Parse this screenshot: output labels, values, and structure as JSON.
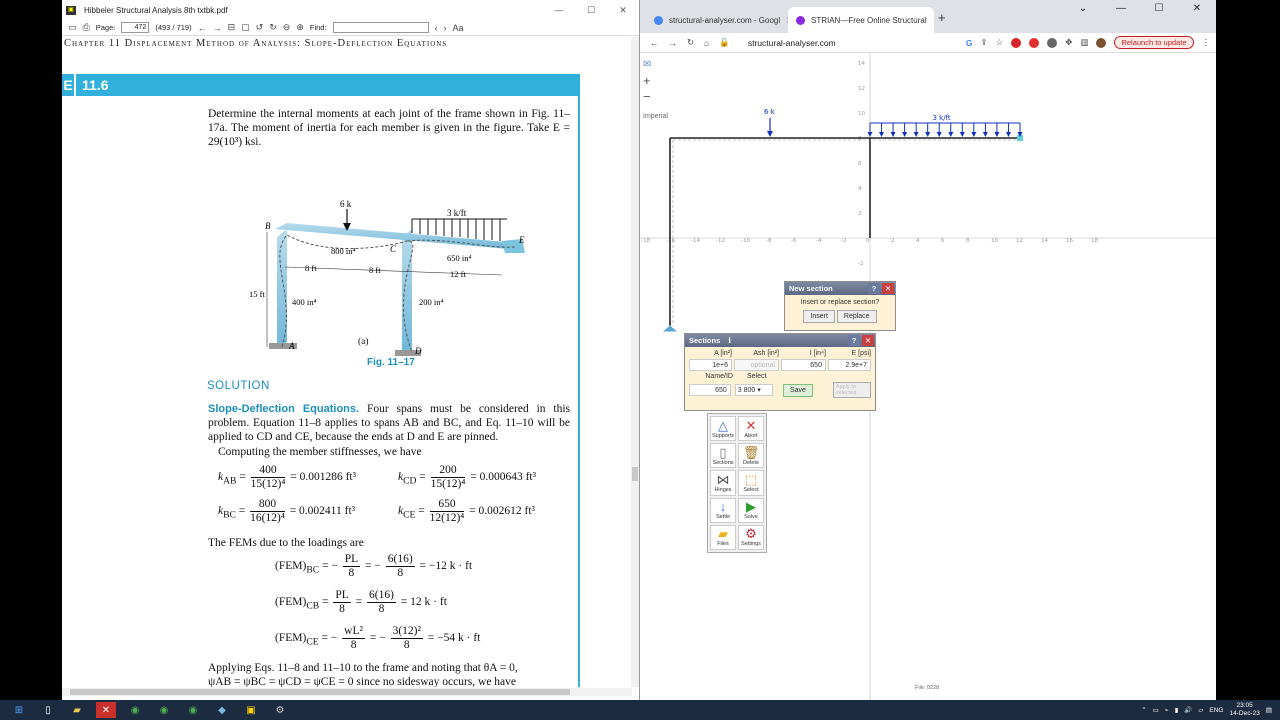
{
  "pdf": {
    "title": "Hibbeler Structural Analysis 8th txtbk.pdf",
    "page_label": "Page:",
    "page_value": "472",
    "page_count": "(493 / 719)",
    "find_label": "Find:",
    "chapter_header": "Chapter 11   Displacement Method of Analysis: Slope-Deflection Equations",
    "example_letter": "E",
    "example_number": "11.6",
    "problem_text": "Determine the internal moments at each joint of the frame shown in Fig. 11–17a. The moment of inertia for each member is given in the figure. Take E = 29(10³) ksi.",
    "figure": {
      "load_point": "6 k",
      "load_dist": "3 k/ft",
      "joint_b": "B",
      "joint_c": "C",
      "joint_a": "A",
      "joint_d": "D",
      "joint_e": "E",
      "i_bc": "800 in⁴",
      "i_ce": "650 in⁴",
      "i_ab": "400 in⁴",
      "i_cd": "200 in⁴",
      "dim1": "8 ft",
      "dim2": "8 ft",
      "dim3": "12 ft",
      "dim_height": "15 ft",
      "sub_label": "(a)",
      "caption": "Fig. 11–17"
    },
    "solution_heading": "SOLUTION",
    "subheading": "Slope-Deflection Equations.",
    "para1": "Four spans must be considered in this problem. Equation 11–8 applies to spans AB and BC, and Eq. 11–10 will be applied to CD and CE, because the ends at D and E are pinned.",
    "para2": "Computing the member stiffnesses, we have",
    "k_ab": {
      "lhs": "k",
      "sub": "AB",
      "num": "400",
      "den": "15(12)⁴",
      "rhs": "= 0.001286 ft³"
    },
    "k_cd": {
      "lhs": "k",
      "sub": "CD",
      "num": "200",
      "den": "15(12)⁴",
      "rhs": "= 0.000643 ft³"
    },
    "k_bc": {
      "lhs": "k",
      "sub": "BC",
      "num": "800",
      "den": "16(12)⁴",
      "rhs": "= 0.002411 ft³"
    },
    "k_ce": {
      "lhs": "k",
      "sub": "CE",
      "num": "650",
      "den": "12(12)⁴",
      "rhs": "= 0.002612 ft³"
    },
    "para3": "The FEMs due to the loadings are",
    "fem_bc": {
      "lhs": "(FEM)",
      "sub": "BC",
      "mid": "= −",
      "n1": "PL",
      "d1": "8",
      "mid2": "= −",
      "n2": "6(16)",
      "d2": "8",
      "rhs": "= −12 k · ft"
    },
    "fem_cb": {
      "lhs": "(FEM)",
      "sub": "CB",
      "mid": "=",
      "n1": "PL",
      "d1": "8",
      "mid2": "=",
      "n2": "6(16)",
      "d2": "8",
      "rhs": "= 12 k · ft"
    },
    "fem_ce": {
      "lhs": "(FEM)",
      "sub": "CE",
      "mid": "= −",
      "n1": "wL²",
      "d1": "8",
      "mid2": "= −",
      "n2": "3(12)²",
      "d2": "8",
      "rhs": "= −54 k · ft"
    },
    "para4": "Applying Eqs. 11–8 and 11–10 to the frame and noting that θA = 0,",
    "para5": "ψAB = ψBC = ψCD = ψCE = 0 since no sidesway occurs, we have"
  },
  "browser": {
    "tab1_title": "structural-analyser.com - Googl",
    "tab2_title": "STRIAN—Free Online Structural",
    "url": "structural-analyser.com",
    "relaunch": "Relaunch to update"
  },
  "strian": {
    "units": "Imperial",
    "load_point": "6 k",
    "load_dist": "3 k/ft",
    "footer": "File: 0228",
    "x_ticks": [
      "-18",
      "-16",
      "-14",
      "-12",
      "-10",
      "-8",
      "-6",
      "-4",
      "-2",
      "0",
      "2",
      "4",
      "6",
      "8",
      "10",
      "12",
      "14",
      "16",
      "18"
    ],
    "y_ticks": [
      "14",
      "12",
      "10",
      "8",
      "6",
      "4",
      "2",
      "-2"
    ],
    "new_section": {
      "title": "New section",
      "question": "Insert or replace section?",
      "insert": "Insert",
      "replace": "Replace"
    },
    "sections": {
      "title": "Sections",
      "col_a": "A [in²]",
      "col_ash": "Ash [in²]",
      "col_i": "I [in⁴]",
      "col_e": "E [psi]",
      "val_a": "1e+6",
      "val_ash_placeholder": "optional",
      "val_i": "650",
      "val_e": "2.9e+7",
      "name_label": "Name/ID",
      "select_label": "Select",
      "name_value": "650",
      "select_value": "3 800",
      "save": "Save",
      "apply": "Apply to selected"
    },
    "tools": [
      "Supports",
      "Abort",
      "Sections",
      "Delete",
      "Hinges",
      "Select",
      "Settle",
      "Solve",
      "Files",
      "Settings"
    ]
  },
  "taskbar": {
    "lang": "ENG",
    "time": "23:05",
    "date": "14-Dec-23"
  }
}
